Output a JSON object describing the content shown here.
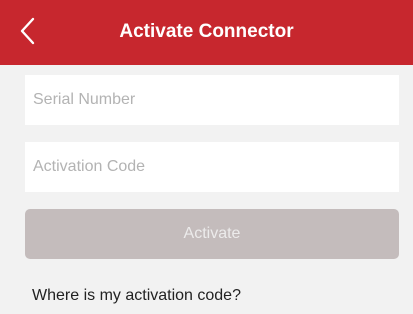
{
  "header": {
    "back_icon": "chevron-left-icon",
    "title": "Activate Connector"
  },
  "form": {
    "serial_number": {
      "value": "",
      "placeholder": "Serial Number"
    },
    "activation_code": {
      "value": "",
      "placeholder": "Activation Code"
    },
    "activate_label": "Activate",
    "activate_enabled": false
  },
  "help": {
    "link_text": "Where is my activation code?"
  },
  "colors": {
    "header_bg": "#c7272e",
    "page_bg": "#f2f2f2",
    "button_disabled_bg": "#c4bcbc"
  }
}
